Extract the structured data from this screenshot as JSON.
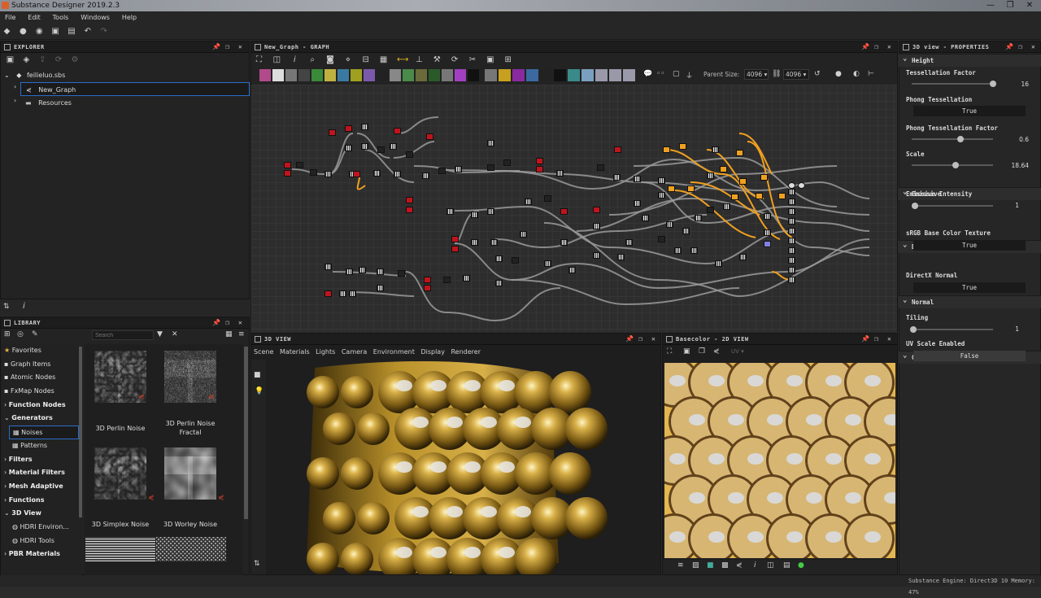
{
  "window": {
    "title": "Substance Designer 2019.2.3"
  },
  "menu": [
    "File",
    "Edit",
    "Tools",
    "Windows",
    "Help"
  ],
  "explorer": {
    "title": "EXPLORER",
    "package": "feilieluo.sbs",
    "graph": "New_Graph",
    "folder": "Resources"
  },
  "library": {
    "title": "LIBRARY",
    "search_placeholder": "Search",
    "categories": [
      {
        "label": "Favorites",
        "bold": false
      },
      {
        "label": "Graph Items",
        "bold": false
      },
      {
        "label": "Atomic Nodes",
        "bold": false
      },
      {
        "label": "FxMap Nodes",
        "bold": false
      },
      {
        "label": "Function Nodes",
        "bold": true
      },
      {
        "label": "Generators",
        "bold": true
      },
      {
        "label": "Noises",
        "bold": false
      },
      {
        "label": "Patterns",
        "bold": false
      },
      {
        "label": "Filters",
        "bold": true
      },
      {
        "label": "Material Filters",
        "bold": true
      },
      {
        "label": "Mesh Adaptive",
        "bold": true
      },
      {
        "label": "Functions",
        "bold": true
      },
      {
        "label": "3D View",
        "bold": true
      },
      {
        "label": "HDRI Environ...",
        "bold": false
      },
      {
        "label": "HDRI Tools",
        "bold": false
      },
      {
        "label": "PBR Materials",
        "bold": true
      }
    ],
    "items": [
      {
        "label": "3D Perlin Noise"
      },
      {
        "label": "3D Perlin Noise Fractal"
      },
      {
        "label": "3D Simplex Noise"
      },
      {
        "label": "3D Worley Noise"
      }
    ]
  },
  "graph": {
    "title": "New_Graph - GRAPH",
    "parent_size_label": "Parent Size:",
    "parent_size": "4096",
    "size_value": "4096"
  },
  "view3d": {
    "title": "3D VIEW",
    "menu": [
      "Scene",
      "Materials",
      "Lights",
      "Camera",
      "Environment",
      "Display",
      "Renderer"
    ]
  },
  "view2d": {
    "title": "Basecolor - 2D VIEW",
    "uv_label": "UV"
  },
  "properties": {
    "title": "3D view - PROPERTIES",
    "sections": {
      "height": "Height",
      "emissive": "Emissive",
      "base_color": "Base Color",
      "normal": "Normal",
      "global": "Global"
    },
    "tessellation_factor": {
      "label": "Tessellation Factor",
      "value": "16",
      "fraction": 0.94
    },
    "phong_tessellation": {
      "label": "Phong Tessellation",
      "value": "True"
    },
    "phong_tessellation_factor": {
      "label": "Phong Tessellation Factor",
      "value": "0.6",
      "fraction": 0.6
    },
    "scale": {
      "label": "Scale",
      "value": "18.64",
      "fraction": 0.5
    },
    "emissive_intensity": {
      "label": "Emissive Intensity",
      "value": "1",
      "fraction": 0.05
    },
    "srgb_base_color": {
      "label": "sRGB Base Color Texture",
      "value": "True"
    },
    "directx_normal": {
      "label": "DirectX Normal",
      "value": "True"
    },
    "tiling": {
      "label": "Tiling",
      "value": "1",
      "fraction": 0.0
    },
    "uv_scale": {
      "label": "UV Scale Enabled",
      "value": "False"
    }
  },
  "status": {
    "text": "Substance Engine: Direct3D 10 Memory: 47%"
  },
  "colors": {
    "accent": "#f0a020",
    "node_red": "#c0141c",
    "selection": "#2c6cc8"
  }
}
